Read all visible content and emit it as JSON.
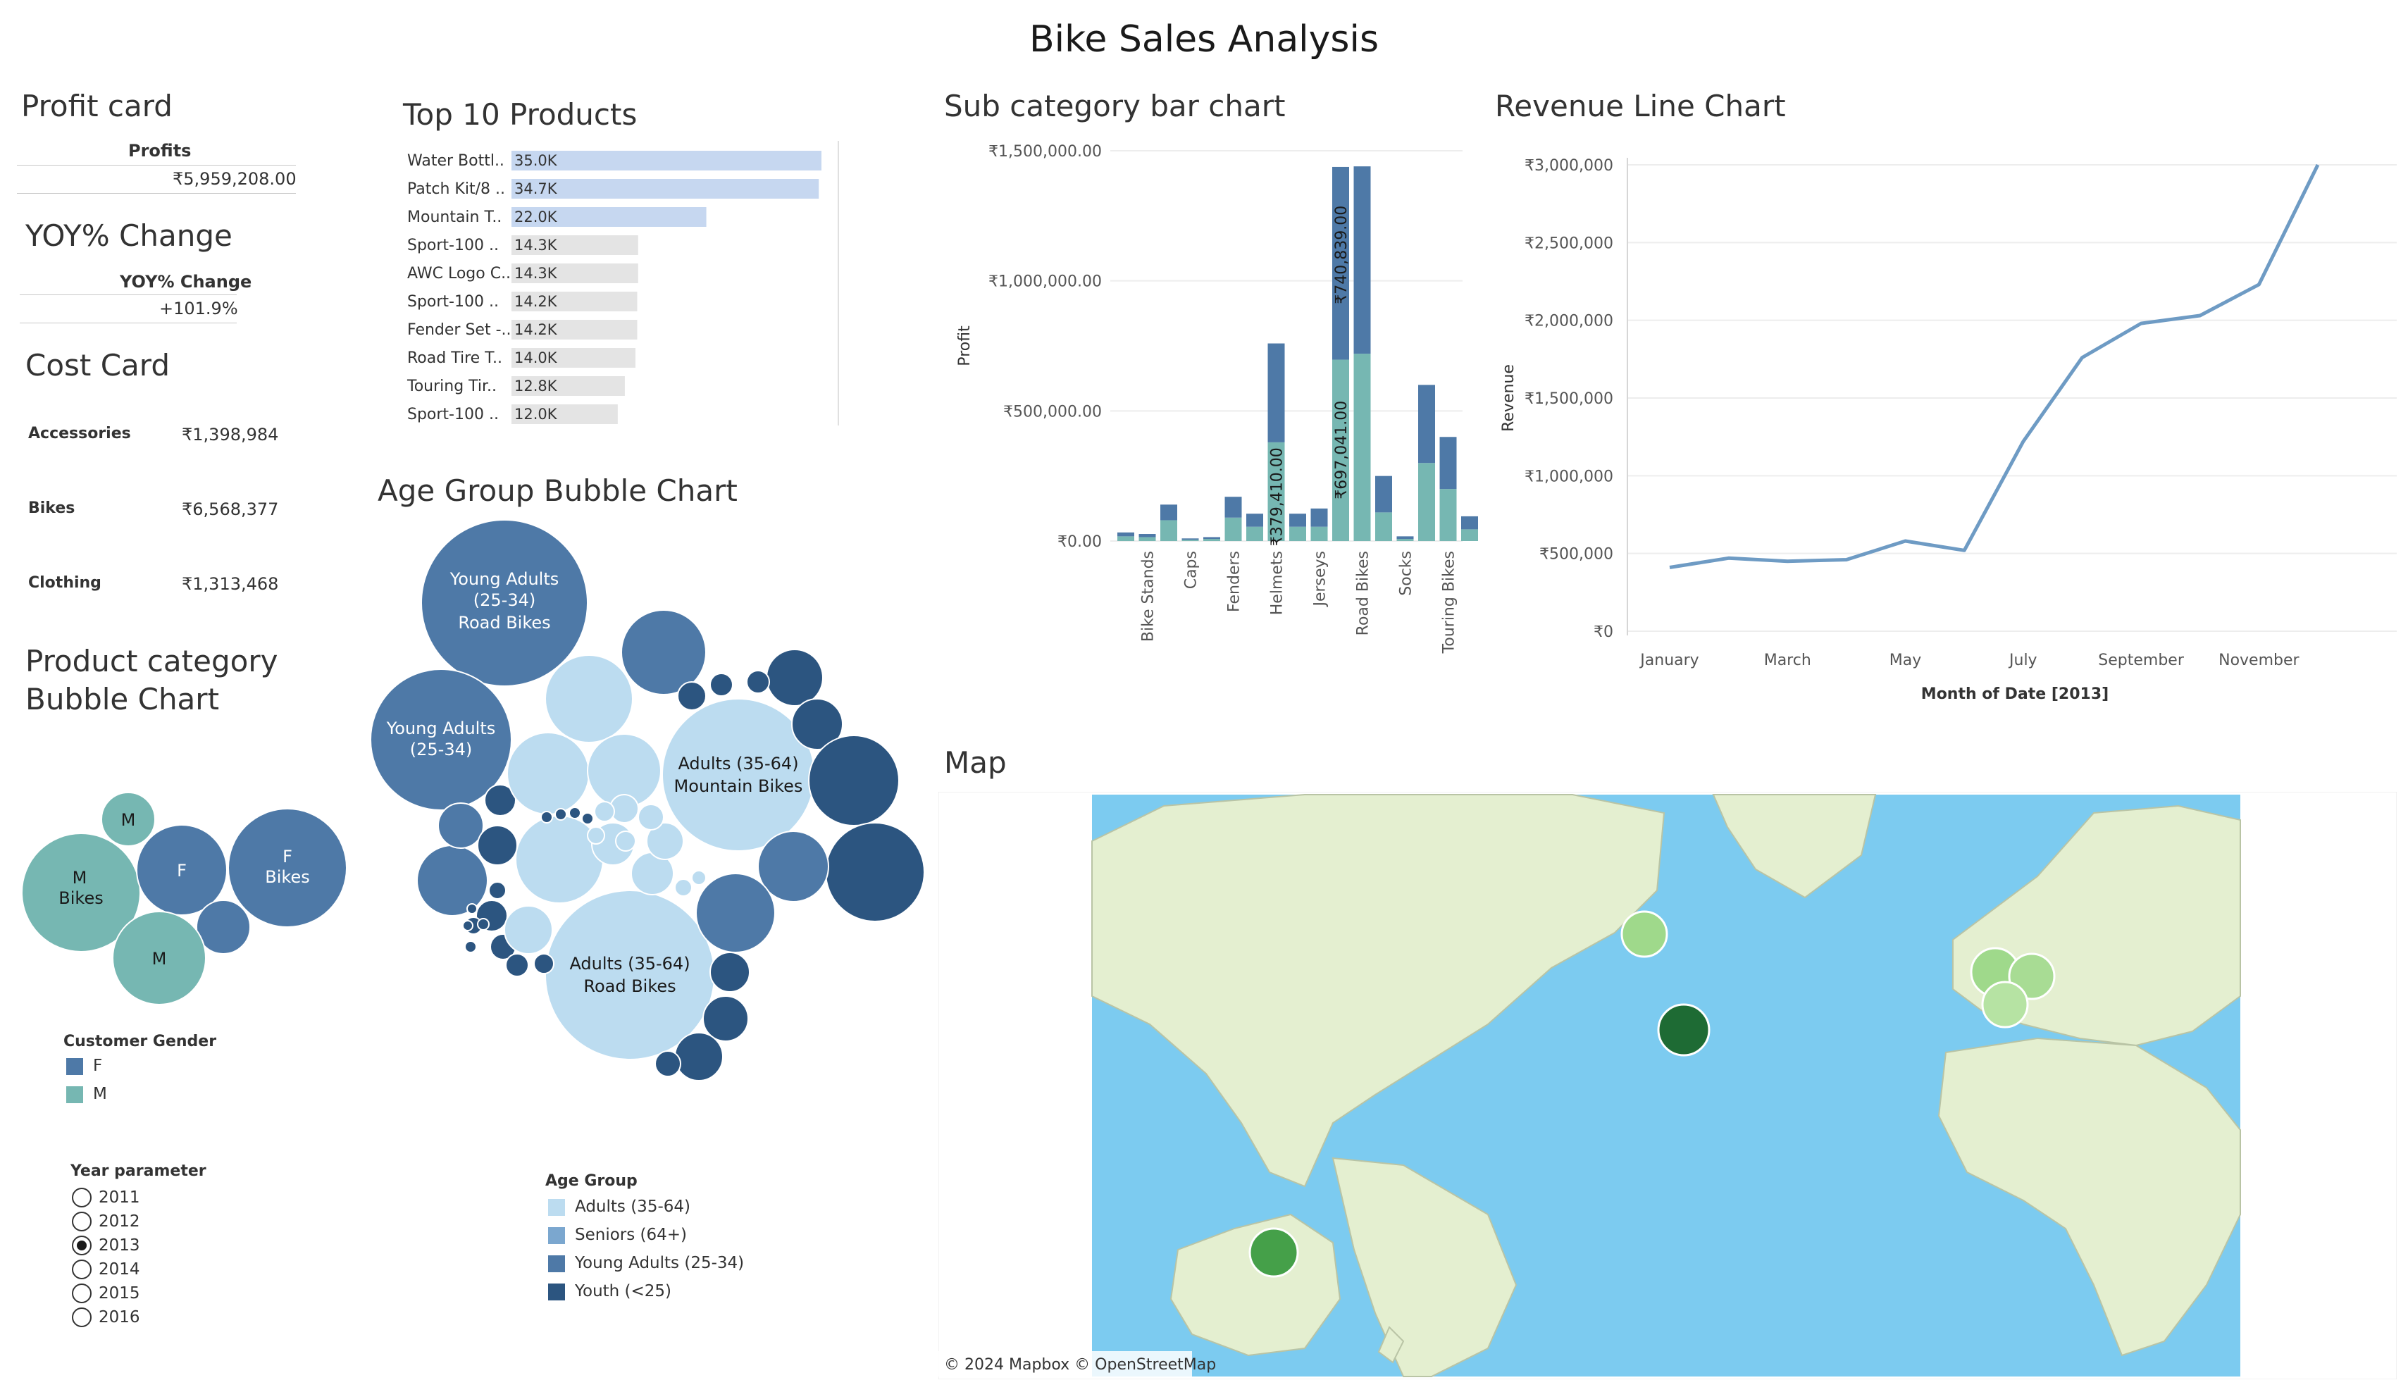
{
  "title": "Bike Sales Analysis",
  "profit_card": {
    "title": "Profit card",
    "header": "Profits",
    "value": "₹5,959,208.00"
  },
  "yoy_card": {
    "title": "YOY% Change",
    "header": "YOY% Change",
    "value": "+101.9%"
  },
  "cost_card": {
    "title": "Cost Card",
    "rows": [
      {
        "label": "Accessories",
        "value": "₹1,398,984"
      },
      {
        "label": "Bikes",
        "value": "₹6,568,377"
      },
      {
        "label": "Clothing",
        "value": "₹1,313,468"
      }
    ]
  },
  "product_bubble": {
    "title_line1": "Product category",
    "title_line2": "Bubble Chart",
    "legend_title": "Customer Gender",
    "legend": [
      {
        "label": "F",
        "color": "#4e79a7"
      },
      {
        "label": "M",
        "color": "#76b7b2"
      }
    ],
    "bubble_labels": [
      "M",
      "M",
      "Bikes",
      "F",
      "F",
      "Bikes",
      "M"
    ]
  },
  "year_parameter": {
    "title": "Year parameter",
    "options": [
      "2011",
      "2012",
      "2013",
      "2014",
      "2015",
      "2016"
    ],
    "selected": "2013"
  },
  "top10": {
    "title": "Top 10 Products",
    "items": [
      {
        "name": "Water Bottl..",
        "label": "35.0K",
        "value": 35.0,
        "highlight": true
      },
      {
        "name": "Patch Kit/8 ..",
        "label": "34.7K",
        "value": 34.7,
        "highlight": true
      },
      {
        "name": "Mountain T..",
        "label": "22.0K",
        "value": 22.0,
        "highlight": true
      },
      {
        "name": "Sport-100 ..",
        "label": "14.3K",
        "value": 14.3,
        "highlight": false
      },
      {
        "name": "AWC Logo C..",
        "label": "14.3K",
        "value": 14.3,
        "highlight": false
      },
      {
        "name": "Sport-100 ..",
        "label": "14.2K",
        "value": 14.2,
        "highlight": false
      },
      {
        "name": "Fender Set -..",
        "label": "14.2K",
        "value": 14.2,
        "highlight": false
      },
      {
        "name": "Road Tire T..",
        "label": "14.0K",
        "value": 14.0,
        "highlight": false
      },
      {
        "name": "Touring Tir..",
        "label": "12.8K",
        "value": 12.8,
        "highlight": false
      },
      {
        "name": "Sport-100 ..",
        "label": "12.0K",
        "value": 12.0,
        "highlight": false
      }
    ]
  },
  "age_bubble": {
    "title": "Age Group Bubble Chart",
    "labels": {
      "ya_road": [
        "Young Adults",
        "(25-34)",
        "Road Bikes"
      ],
      "ya": [
        "Young Adults",
        "(25-34)"
      ],
      "ad_mtb": [
        "Adults (35-64)",
        "Mountain Bikes"
      ],
      "ad_road": [
        "Adults (35-64)",
        "Road Bikes"
      ]
    },
    "legend_title": "Age Group",
    "legend": [
      {
        "label": "Adults (35-64)",
        "color": "#bcdcf0"
      },
      {
        "label": "Seniors (64+)",
        "color": "#7ba7cf"
      },
      {
        "label": "Young Adults (25-34)",
        "color": "#4e79a7"
      },
      {
        "label": "Youth (<25)",
        "color": "#2c5580"
      }
    ]
  },
  "subcat": {
    "title": "Sub category bar chart",
    "ylabel": "Profit",
    "yticks": [
      "₹1,500,000.00",
      "₹1,000,000.00",
      "₹500,000.00",
      "₹0.00"
    ],
    "xlabels": [
      "Bike Stands",
      "Caps",
      "Fenders",
      "Helmets",
      "Jerseys",
      "Road Bikes",
      "Socks",
      "Touring Bikes"
    ],
    "annotations": [
      "₹379,410.00",
      "₹740,839.00",
      "₹697,041.00"
    ],
    "colors": {
      "f": "#4e79a7",
      "m": "#76b7b2"
    }
  },
  "revenue": {
    "title": "Revenue Line Chart",
    "ylabel": "Revenue",
    "xlabel": "Month of Date [2013]",
    "yticks": [
      "₹3,000,000",
      "₹2,500,000",
      "₹2,000,000",
      "₹1,500,000",
      "₹1,000,000",
      "₹500,000",
      "₹0"
    ],
    "xticks": [
      "January",
      "March",
      "May",
      "July",
      "September",
      "November"
    ],
    "color": "#6e9bc4"
  },
  "map": {
    "title": "Map",
    "attribution": "© 2024 Mapbox © OpenStreetMap",
    "colors": {
      "water": "#7ccbf0",
      "land": "#e4efd0",
      "dark": "#1e6b34",
      "mid": "#45a049",
      "light": "#9fd98b"
    }
  },
  "chart_data": [
    {
      "type": "bar",
      "title": "Top 10 Products",
      "categories": [
        "Water Bottl..",
        "Patch Kit/8 ..",
        "Mountain T..",
        "Sport-100 ..",
        "AWC Logo C..",
        "Sport-100 ..",
        "Fender Set -..",
        "Road Tire T..",
        "Touring Tir..",
        "Sport-100 .."
      ],
      "values": [
        35.0,
        34.7,
        22.0,
        14.3,
        14.3,
        14.2,
        14.2,
        14.0,
        12.8,
        12.0
      ],
      "orientation": "horizontal"
    },
    {
      "type": "bar",
      "title": "Sub category bar chart",
      "ylabel": "Profit",
      "ylim": [
        0,
        1500000
      ],
      "stacked": true,
      "categories": [
        "",
        "Bike Stands",
        "",
        "Caps",
        "",
        "Fenders",
        "",
        "Helmets",
        "",
        "Jerseys",
        "",
        "Road Bikes",
        "",
        "Socks",
        "",
        "Touring Bikes",
        ""
      ],
      "series": [
        {
          "values": [
            18000,
            15000,
            80000,
            5000,
            8000,
            90000,
            55000,
            379410,
            55000,
            55000,
            697041,
            720000,
            110000,
            8000,
            300000,
            200000,
            45000
          ]
        },
        {
          "values": [
            15000,
            12000,
            60000,
            5000,
            7000,
            80000,
            50000,
            380000,
            50000,
            70000,
            740839,
            720000,
            140000,
            10000,
            300000,
            200000,
            50000
          ]
        }
      ]
    },
    {
      "type": "line",
      "title": "Revenue Line Chart",
      "xlabel": "Month of Date [2013]",
      "ylabel": "Revenue",
      "ylim": [
        0,
        3000000
      ],
      "x": [
        "January",
        "February",
        "March",
        "April",
        "May",
        "June",
        "July",
        "August",
        "September",
        "October",
        "November",
        "December"
      ],
      "y": [
        410000,
        470000,
        450000,
        460000,
        580000,
        520000,
        1220000,
        1760000,
        1980000,
        2030000,
        2230000,
        3000000
      ]
    }
  ]
}
